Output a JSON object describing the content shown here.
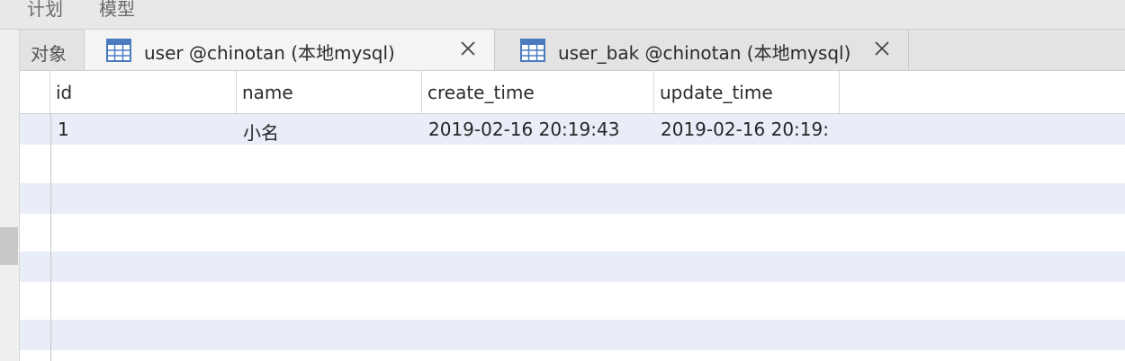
{
  "menu": {
    "items": [
      "计划",
      "模型"
    ]
  },
  "tabs": {
    "objects_label": "对象",
    "items": [
      {
        "label": "user @chinotan (本地mysql)",
        "active": true,
        "icon": "table-icon",
        "close": "close-icon"
      },
      {
        "label": "user_bak @chinotan (本地mysql)",
        "active": false,
        "icon": "table-icon",
        "close": "close-icon"
      }
    ]
  },
  "grid": {
    "columns": [
      "id",
      "name",
      "create_time",
      "update_time"
    ],
    "rows": [
      {
        "id": "1",
        "name": "小名",
        "create_time": "2019-02-16 20:19:43",
        "update_time": "2019-02-16 20:19:"
      }
    ]
  },
  "colors": {
    "stripe": "#e9edf7",
    "tab_active": "#f4f4f4",
    "tab_inactive": "#e3e3e3",
    "icon_blue": "#4a7bbf"
  }
}
